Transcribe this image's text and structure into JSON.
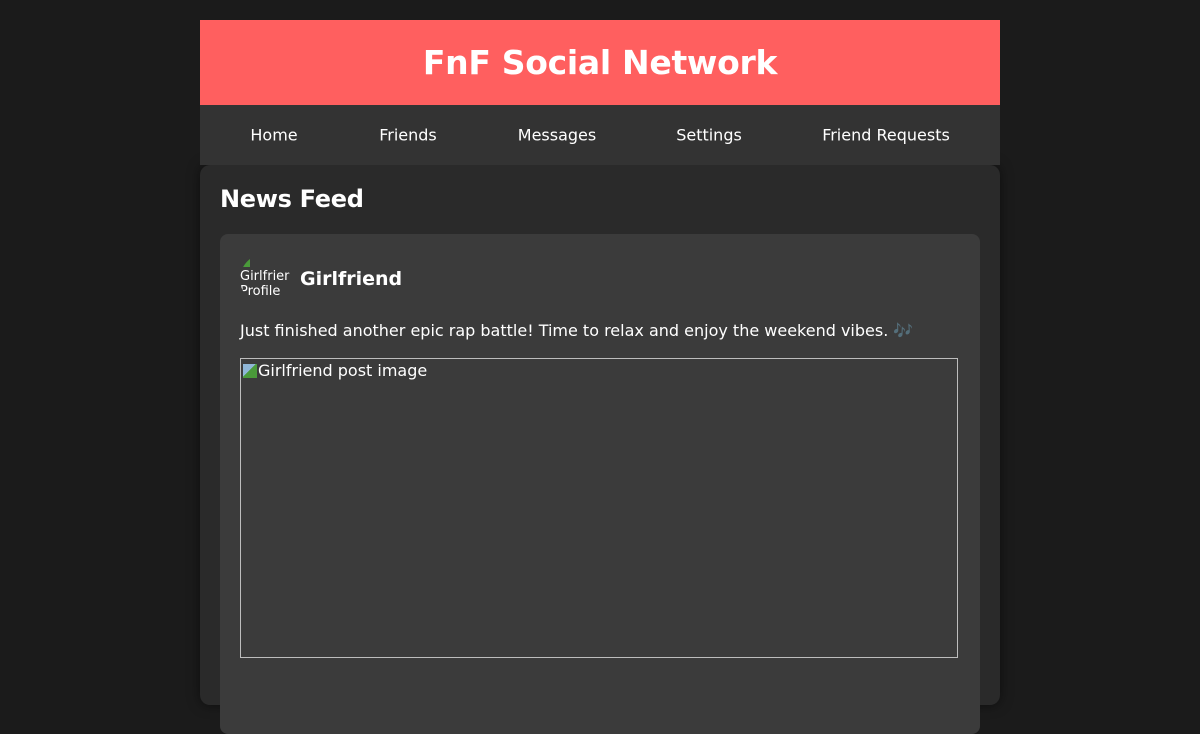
{
  "header": {
    "title": "FnF Social Network",
    "background_color": "#ff5f5f"
  },
  "nav": {
    "items": [
      {
        "label": "Home"
      },
      {
        "label": "Friends"
      },
      {
        "label": "Messages"
      },
      {
        "label": "Settings"
      },
      {
        "label": "Friend Requests"
      }
    ]
  },
  "feed": {
    "title": "News Feed",
    "posts": [
      {
        "author": "Girlfriend",
        "avatar_alt": "Girlfriend Profile",
        "text": "Just finished another epic rap battle! Time to relax and enjoy the weekend vibes. 🎶",
        "image_alt": "Girlfriend post image"
      }
    ]
  }
}
